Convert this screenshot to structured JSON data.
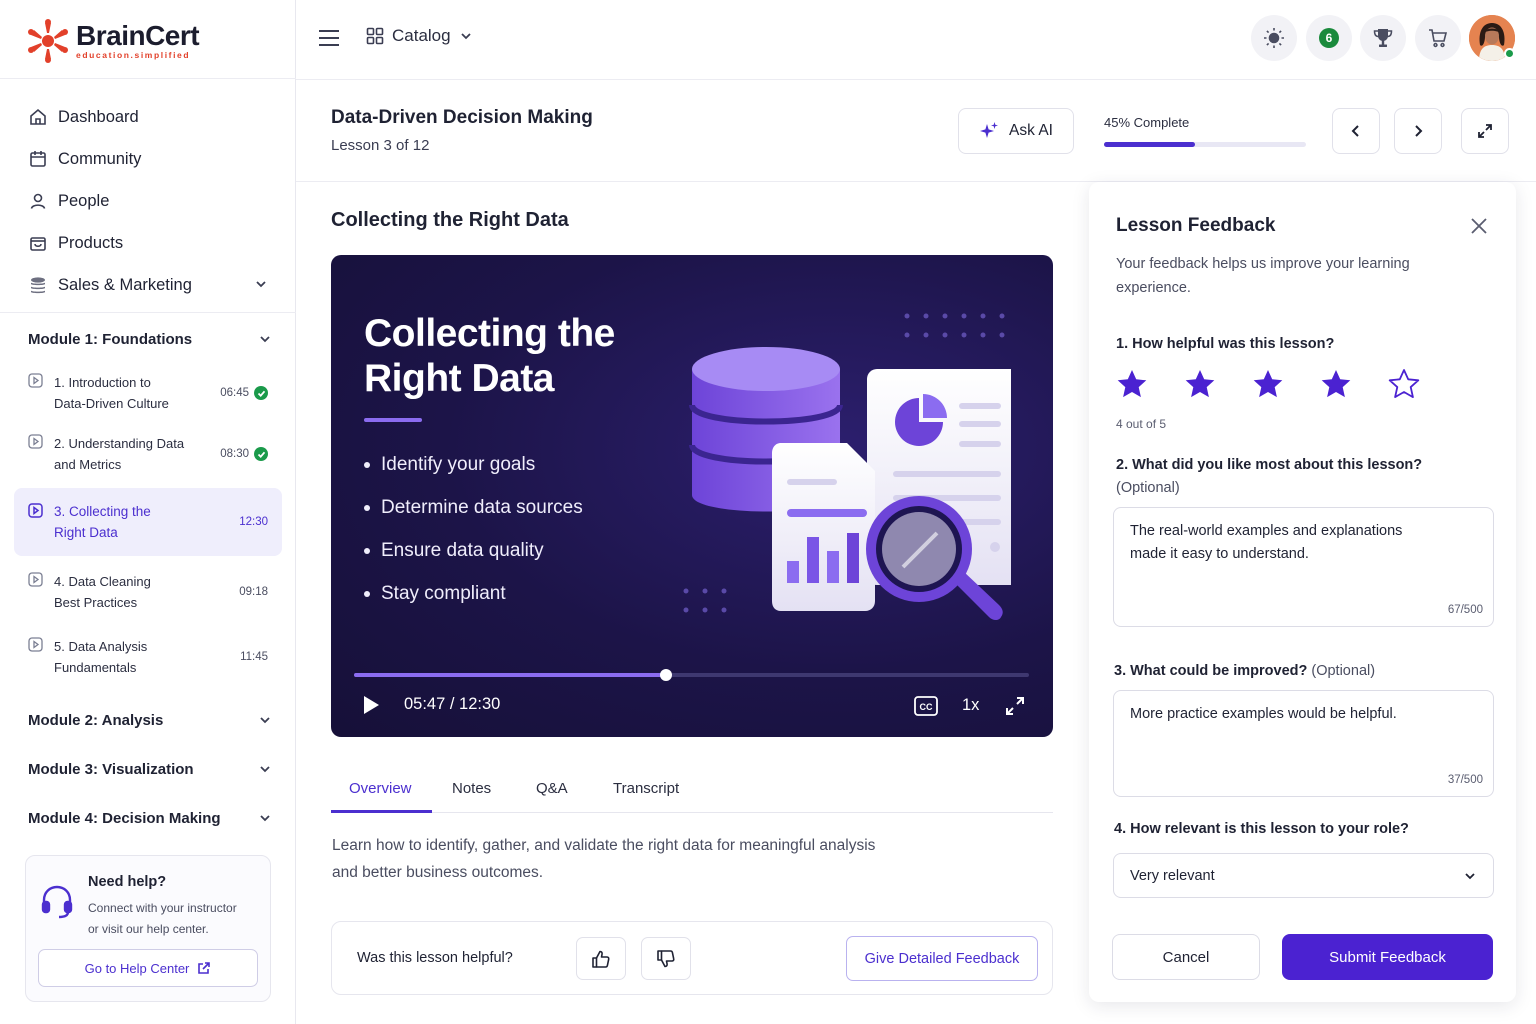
{
  "brand": {
    "name": "BrainCert",
    "tagline": "education.simplified"
  },
  "nav": {
    "items": [
      {
        "label": "Dashboard",
        "icon": "home-icon"
      },
      {
        "label": "Community",
        "icon": "calendar-icon"
      },
      {
        "label": "People",
        "icon": "user-icon"
      },
      {
        "label": "Products",
        "icon": "shopping-bag-icon"
      },
      {
        "label": "Sales & Marketing",
        "icon": "coins-icon"
      }
    ]
  },
  "modules": {
    "m1": "Module 1: Foundations",
    "m2": "Module 2: Analysis",
    "m3": "Module 3: Visualization",
    "m4": "Module 4: Decision Making"
  },
  "lessons": [
    {
      "line1": "1. Introduction to",
      "line2": "Data-Driven Culture",
      "duration": "06:45",
      "completed": true
    },
    {
      "line1": "2. Understanding Data",
      "line2": "and Metrics",
      "duration": "08:30",
      "completed": true
    },
    {
      "line1": "3. Collecting the",
      "line2": "Right Data",
      "duration": "12:30",
      "active": true
    },
    {
      "line1": "4. Data Cleaning",
      "line2": "Best Practices",
      "duration": "09:18"
    },
    {
      "line1": "5. Data Analysis",
      "line2": "Fundamentals",
      "duration": "11:45"
    }
  ],
  "help": {
    "title": "Need help?",
    "line1": "Connect with your instructor",
    "line2": "or visit our help center.",
    "button": "Go to Help Center"
  },
  "topbar": {
    "catalog": "Catalog",
    "notifications": "6"
  },
  "lesson_header": {
    "title": "Data-Driven Decision Making",
    "subtitle": "Lesson 3 of 12",
    "ask_ai": "Ask AI",
    "progress_label": "45% Complete",
    "progress": 0.45
  },
  "main": {
    "title": "Collecting the Right Data",
    "video": {
      "title_line1": "Collecting the",
      "title_line2": "Right Data",
      "bullets": [
        "Identify your goals",
        "Determine data sources",
        "Ensure data quality",
        "Stay compliant"
      ],
      "time": "05:47 / 12:30",
      "progress": 0.462,
      "speed": "1x",
      "cc": "CC"
    },
    "tabs": [
      "Overview",
      "Notes",
      "Q&A",
      "Transcript"
    ],
    "description_line1": "Learn how to identify, gather, and validate the right data for meaningful analysis",
    "description_line2": "and better business outcomes.",
    "helpful_label": "Was this lesson helpful?",
    "detailed_feedback": "Give Detailed Feedback"
  },
  "feedback": {
    "title": "Lesson Feedback",
    "subtitle_line1": "Your feedback helps us improve your learning",
    "subtitle_line2": "experience.",
    "q1": "1. How helpful was this lesson?",
    "rating": 4,
    "rating_max": 5,
    "rating_note": "4 out of 5",
    "q2": "2. What did you like most about this lesson?",
    "q2_optional": "(Optional)",
    "q2_answer_line1": "The real-world examples and explanations",
    "q2_answer_line2": "made it easy to understand.",
    "q2_count": "67/500",
    "q3": "3. What could be improved?",
    "q3_optional": "(Optional)",
    "q3_answer": "More practice examples would be helpful.",
    "q3_count": "37/500",
    "q4": "4. How relevant is this lesson to your role?",
    "q4_value": "Very relevant",
    "cancel": "Cancel",
    "submit": "Submit Feedback"
  },
  "colors": {
    "accent": "#4b2fcf",
    "success": "#1a9a4a",
    "brand_red": "#e2402a"
  }
}
